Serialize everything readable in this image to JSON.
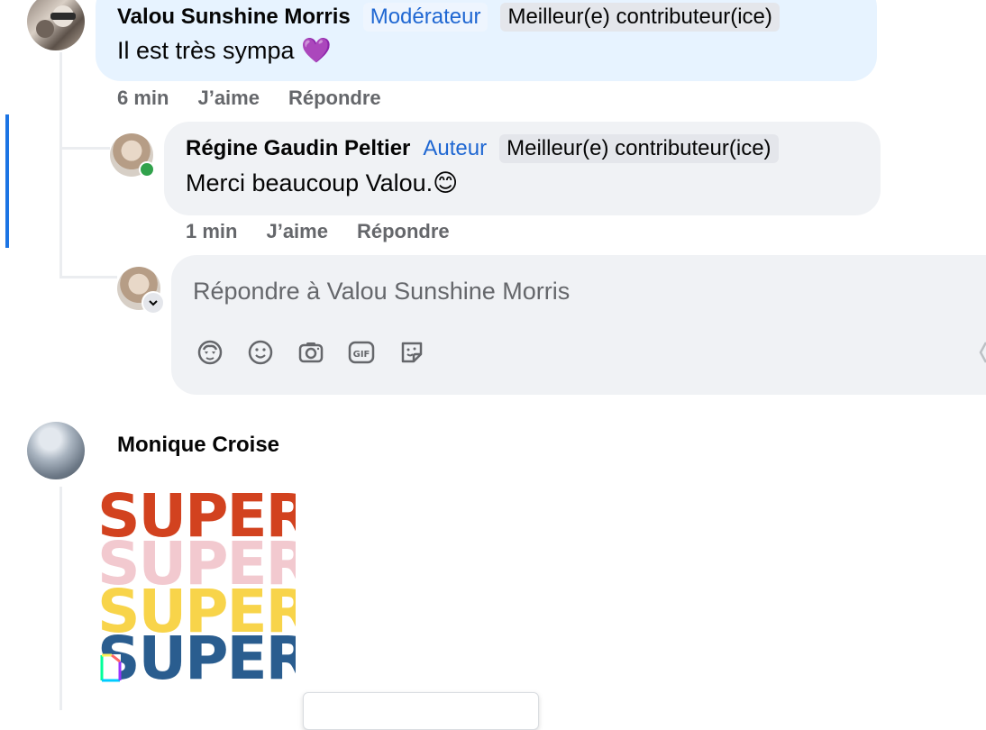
{
  "comments": [
    {
      "author": "Valou Sunshine Morris",
      "role": "Modérateur",
      "badge": "Meilleur(e) contributeur(ice)",
      "text": "Il est très sympa 💜",
      "time": "6 min",
      "like_label": "J’aime",
      "reply_label": "Répondre"
    },
    {
      "author": "Régine Gaudin Peltier",
      "role": "Auteur",
      "badge": "Meilleur(e) contributeur(ice)",
      "text": "Merci beaucoup Valou.😊",
      "time": "1 min",
      "like_label": "J’aime",
      "reply_label": "Répondre"
    },
    {
      "author": "Monique Croise",
      "gif_words": [
        "SUPER",
        "SUPER",
        "SUPER",
        "SUPER"
      ]
    }
  ],
  "reply_box": {
    "placeholder": "Répondre à Valou Sunshine Morris",
    "tools": [
      "avatar-sticker-icon",
      "emoji-icon",
      "camera-icon",
      "gif-icon",
      "sticker-icon"
    ]
  },
  "colors": {
    "accent_blue": "#1f67d2",
    "online_green": "#31a24c",
    "highlight_bar": "#1b74e4",
    "super_red": "#d2421f",
    "super_pink": "#f2c9cf",
    "super_yellow": "#f8d44a",
    "super_blue": "#2a5d8f"
  }
}
